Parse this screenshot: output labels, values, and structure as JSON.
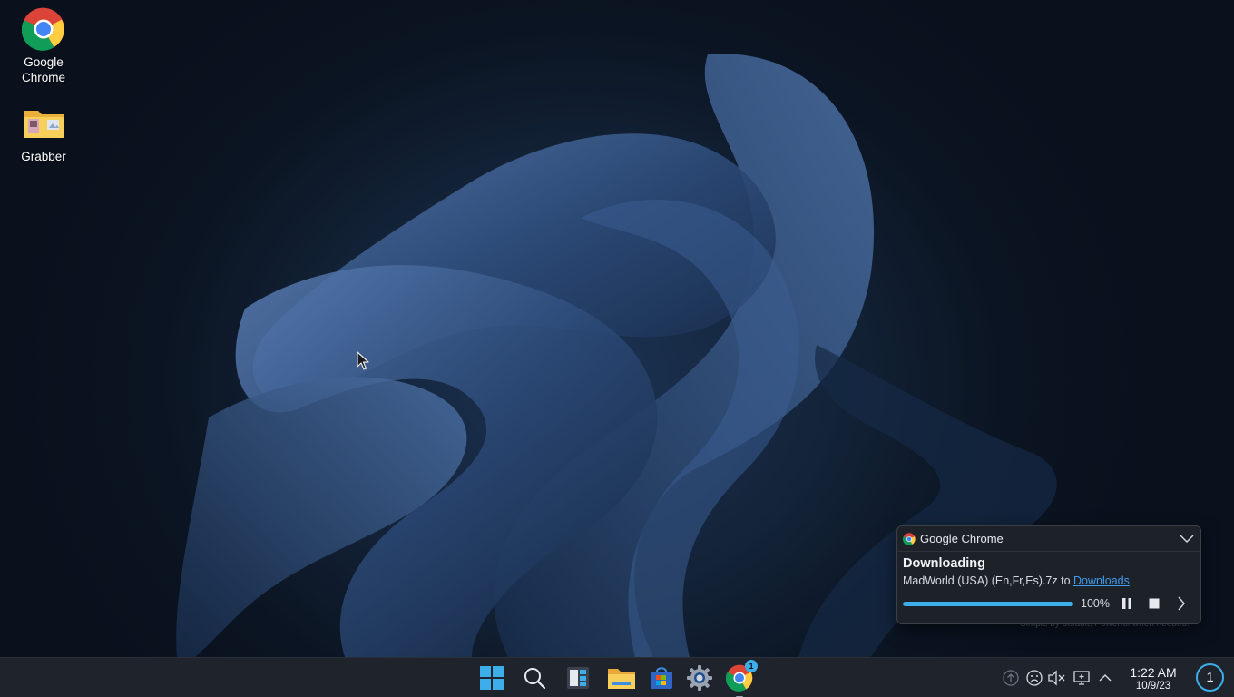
{
  "desktop": {
    "icons": [
      {
        "label": "Google Chrome",
        "icon": "chrome-icon"
      },
      {
        "label": "Grabber",
        "icon": "folder-icon"
      }
    ],
    "watermark": "Simple by default, Powerful when needed."
  },
  "notification": {
    "app_name": "Google Chrome",
    "title": "Downloading",
    "file_text": "MadWorld (USA) (En,Fr,Es).7z to ",
    "link_text": "Downloads",
    "progress_percent": 100,
    "progress_label": "100%",
    "accent": "#3daee9"
  },
  "taskbar": {
    "apps": [
      {
        "name": "start-icon"
      },
      {
        "name": "search-icon"
      },
      {
        "name": "widgets-icon"
      },
      {
        "name": "file-explorer-icon"
      },
      {
        "name": "store-icon"
      },
      {
        "name": "settings-icon"
      },
      {
        "name": "chrome-icon",
        "badge": "1"
      }
    ],
    "tray": [
      "updates-icon",
      "sad-face-icon",
      "volume-muted-icon",
      "display-icon",
      "chevron-up-icon"
    ],
    "time": "1:22 AM",
    "date": "10/9/23",
    "notification_count": "1"
  }
}
